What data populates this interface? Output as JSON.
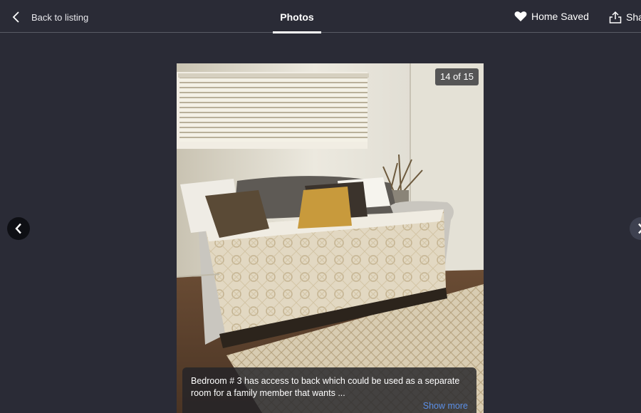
{
  "header": {
    "back_label": "Back to listing",
    "tab_label": "Photos",
    "saved_label": "Home Saved",
    "share_label": "Share"
  },
  "icons": {
    "back": "chevron-left-icon",
    "saved": "heart-icon",
    "share": "share-icon",
    "prev": "chevron-left-icon",
    "next": "chevron-right-icon"
  },
  "photo": {
    "counter": "14 of 15",
    "caption": "Bedroom # 3 has access to back which could be used as a separate room for a family member that wants ...",
    "show_more": "Show more"
  },
  "colors": {
    "background": "#2a2b36",
    "link": "#5b8fe6"
  }
}
